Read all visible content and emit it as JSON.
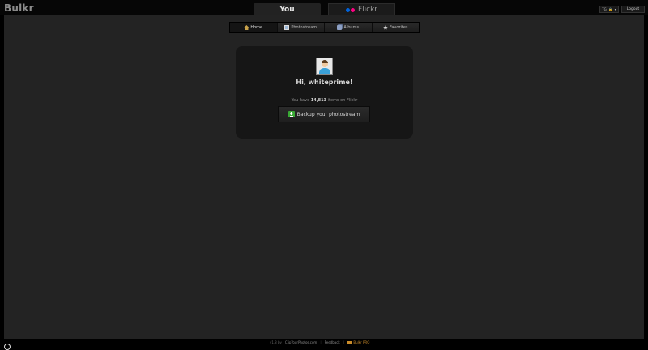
{
  "app": {
    "logo": "Bulkr"
  },
  "top_tabs": {
    "you": "You",
    "flickr": "Flickr"
  },
  "flickr_colors": {
    "blue": "#0063dc",
    "pink": "#ff0084"
  },
  "top_right": {
    "lang": "TG",
    "logout": "Logout"
  },
  "subnav": [
    {
      "label": "Home",
      "icon": "home-icon"
    },
    {
      "label": "Photostream",
      "icon": "photo-icon"
    },
    {
      "label": "Albums",
      "icon": "albums-icon"
    },
    {
      "label": "Favorites",
      "icon": "star-icon"
    }
  ],
  "panel": {
    "greeting": "Hi, whiteprime!",
    "items_prefix": "You have",
    "items_count": "14,813",
    "items_suffix": "items on Flickr",
    "backup_label": "Backup your photostream"
  },
  "footer": {
    "version": "v1.8 by",
    "credit": "ClipYourPhotos.com",
    "feedback": "Feedback",
    "pro": "Bulkr PRO"
  }
}
